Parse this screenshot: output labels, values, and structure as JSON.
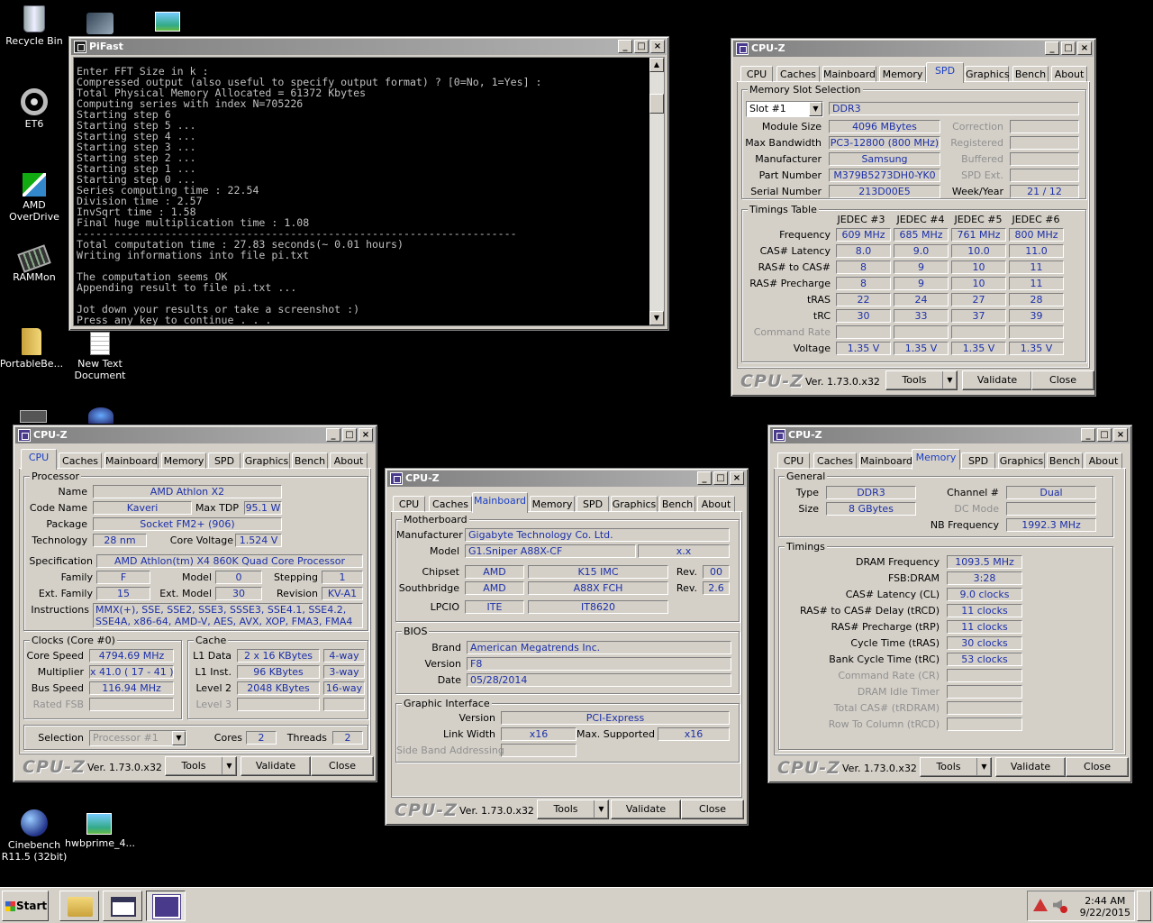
{
  "desktop": {
    "icons": [
      {
        "label": "Recycle Bin"
      },
      {
        "label": "ET6"
      },
      {
        "label": "AMD OverDrive"
      },
      {
        "label": "RAMMon"
      },
      {
        "label": "PortableBe..."
      },
      {
        "label": "New Text Document"
      },
      {
        "label": "Cinebench R11.5 (32bit)"
      },
      {
        "label": "hwbprime_4..."
      }
    ]
  },
  "pifast": {
    "title": "PiFast",
    "output": "Enter FFT Size in k :\nCompressed output (also useful to specify output format) ? [0=No, 1=Yes] :\nTotal Physical Memory Allocated = 61372 Kbytes\nComputing series with index N=705226\nStarting step 6\nStarting step 5 ...\nStarting step 4 ...\nStarting step 3 ...\nStarting step 2 ...\nStarting step 1 ...\nStarting step 0 ...\nSeries computing time : 22.54\nDivision time : 2.57\nInvSqrt time : 1.58\nFinal huge multiplication time : 1.08\n----------------------------------------------------------------------\nTotal computation time : 27.83 seconds(~ 0.01 hours)\nWriting informations into file pi.txt\n\nThe computation seems OK\nAppending result to file pi.txt ...\n\nJot down your results or take a screenshot :)\nPress any key to continue . . ."
  },
  "common": {
    "title": "CPU-Z",
    "brand": "CPU-Z",
    "version": "Ver. 1.73.0.x32",
    "tools": "Tools",
    "validate": "Validate",
    "close": "Close",
    "tabs": [
      "CPU",
      "Caches",
      "Mainboard",
      "Memory",
      "SPD",
      "Graphics",
      "Bench",
      "About"
    ]
  },
  "spd": {
    "slot_group": "Memory Slot Selection",
    "slot": "Slot #1",
    "type": "DDR3",
    "labels": {
      "module_size": "Module Size",
      "max_bw": "Max Bandwidth",
      "manufacturer": "Manufacturer",
      "part": "Part Number",
      "serial": "Serial Number",
      "correction": "Correction",
      "registered": "Registered",
      "buffered": "Buffered",
      "spd_ext": "SPD Ext.",
      "week_year": "Week/Year"
    },
    "module_size": "4096 MBytes",
    "max_bandwidth": "PC3-12800 (800 MHz)",
    "manufacturer": "Samsung",
    "part_number": "M379B5273DH0-YK0",
    "serial_number": "213D00E5",
    "week_year": "21 / 12",
    "timings_group": "Timings Table",
    "jedec_headers": [
      "JEDEC #3",
      "JEDEC #4",
      "JEDEC #5",
      "JEDEC #6"
    ],
    "rows": [
      {
        "label": "Frequency",
        "values": [
          "609 MHz",
          "685 MHz",
          "761 MHz",
          "800 MHz"
        ]
      },
      {
        "label": "CAS# Latency",
        "values": [
          "8.0",
          "9.0",
          "10.0",
          "11.0"
        ]
      },
      {
        "label": "RAS# to CAS#",
        "values": [
          "8",
          "9",
          "10",
          "11"
        ]
      },
      {
        "label": "RAS# Precharge",
        "values": [
          "8",
          "9",
          "10",
          "11"
        ]
      },
      {
        "label": "tRAS",
        "values": [
          "22",
          "24",
          "27",
          "28"
        ]
      },
      {
        "label": "tRC",
        "values": [
          "30",
          "33",
          "37",
          "39"
        ]
      },
      {
        "label": "Command Rate",
        "values": [
          "",
          "",
          "",
          ""
        ]
      },
      {
        "label": "Voltage",
        "values": [
          "1.35 V",
          "1.35 V",
          "1.35 V",
          "1.35 V"
        ]
      }
    ]
  },
  "cpu": {
    "processor_group": "Processor",
    "labels": {
      "name": "Name",
      "code_name": "Code Name",
      "max_tdp": "Max TDP",
      "package": "Package",
      "technology": "Technology",
      "core_voltage": "Core Voltage",
      "specification": "Specification",
      "family": "Family",
      "model": "Model",
      "stepping": "Stepping",
      "ext_family": "Ext. Family",
      "ext_model": "Ext. Model",
      "revision": "Revision",
      "instructions": "Instructions"
    },
    "name": "AMD Athlon X2",
    "code_name": "Kaveri",
    "max_tdp": "95.1 W",
    "package": "Socket FM2+ (906)",
    "technology": "28 nm",
    "core_voltage": "1.524 V",
    "specification": "AMD Athlon(tm) X4 860K Quad Core Processor",
    "family": "F",
    "model": "0",
    "stepping": "1",
    "ext_family": "15",
    "ext_model": "30",
    "revision": "KV-A1",
    "instructions": "MMX(+), SSE, SSE2, SSE3, SSSE3, SSE4.1, SSE4.2, SSE4A, x86-64, AMD-V, AES, AVX, XOP, FMA3, FMA4",
    "clocks_group": "Clocks (Core #0)",
    "clock_labels": {
      "core_speed": "Core Speed",
      "multiplier": "Multiplier",
      "bus_speed": "Bus Speed",
      "rated_fsb": "Rated FSB"
    },
    "core_speed": "4794.69 MHz",
    "multiplier": "x 41.0 ( 17 - 41 )",
    "bus_speed": "116.94 MHz",
    "cache_group": "Cache",
    "cache_labels": {
      "l1d": "L1 Data",
      "l1i": "L1 Inst.",
      "l2": "Level 2",
      "l3": "Level 3"
    },
    "l1d": "2 x 16 KBytes",
    "l1d_way": "4-way",
    "l1i": "96 KBytes",
    "l1i_way": "3-way",
    "l2": "2048 KBytes",
    "l2_way": "16-way",
    "selection_label": "Selection",
    "selection": "Processor #1",
    "cores_label": "Cores",
    "cores": "2",
    "threads_label": "Threads",
    "threads": "2"
  },
  "mainboard": {
    "mb_group": "Motherboard",
    "labels": {
      "manufacturer": "Manufacturer",
      "model": "Model",
      "chipset": "Chipset",
      "southbridge": "Southbridge",
      "lpcio": "LPCIO",
      "rev": "Rev."
    },
    "manufacturer": "Gigabyte Technology Co. Ltd.",
    "model": "G1.Sniper A88X-CF",
    "model_rev": "x.x",
    "chipset_vendor": "AMD",
    "chipset": "K15 IMC",
    "chipset_rev": "00",
    "sb_vendor": "AMD",
    "southbridge": "A88X FCH",
    "sb_rev": "2.6",
    "lpcio_vendor": "ITE",
    "lpcio": "IT8620",
    "bios_group": "BIOS",
    "bios_labels": {
      "brand": "Brand",
      "version": "Version",
      "date": "Date"
    },
    "bios_brand": "American Megatrends Inc.",
    "bios_version": "F8",
    "bios_date": "05/28/2014",
    "gi_group": "Graphic Interface",
    "gi_labels": {
      "version": "Version",
      "link_width": "Link Width",
      "max_supported": "Max. Supported",
      "side_band": "Side Band Addressing"
    },
    "gi_version": "PCI-Express",
    "link_width": "x16",
    "max_supported": "x16"
  },
  "memory": {
    "general_group": "General",
    "labels": {
      "type": "Type",
      "size": "Size",
      "channel": "Channel #",
      "dc_mode": "DC Mode",
      "nb_freq": "NB Frequency"
    },
    "type": "DDR3",
    "size": "8 GBytes",
    "channel": "Dual",
    "nb_frequency": "1992.3 MHz",
    "timings_group": "Timings",
    "rows": [
      {
        "label": "DRAM Frequency",
        "value": "1093.5 MHz"
      },
      {
        "label": "FSB:DRAM",
        "value": "3:28"
      },
      {
        "label": "CAS# Latency (CL)",
        "value": "9.0 clocks"
      },
      {
        "label": "RAS# to CAS# Delay (tRCD)",
        "value": "11 clocks"
      },
      {
        "label": "RAS# Precharge (tRP)",
        "value": "11 clocks"
      },
      {
        "label": "Cycle Time (tRAS)",
        "value": "30 clocks"
      },
      {
        "label": "Bank Cycle Time (tRC)",
        "value": "53 clocks"
      },
      {
        "label": "Command Rate (CR)",
        "value": ""
      },
      {
        "label": "DRAM Idle Timer",
        "value": ""
      },
      {
        "label": "Total CAS# (tRDRAM)",
        "value": ""
      },
      {
        "label": "Row To Column (tRCD)",
        "value": ""
      }
    ]
  },
  "taskbar": {
    "start": "Start",
    "time": "2:44 AM",
    "date": "9/22/2015"
  }
}
